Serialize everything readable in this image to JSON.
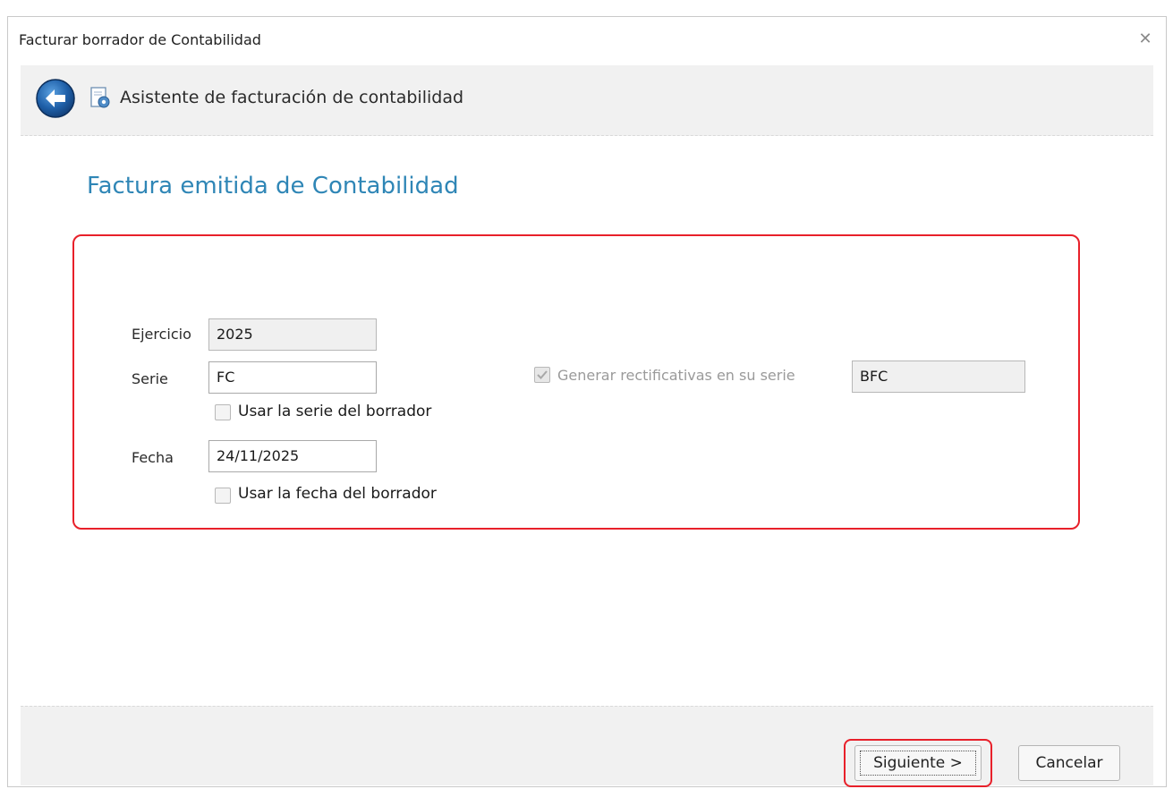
{
  "window": {
    "title": "Facturar borrador de Contabilidad",
    "close_glyph": "✕"
  },
  "wizard": {
    "title": "Asistente de facturación de contabilidad",
    "back_icon": "back-arrow-icon",
    "doc_icon": "document-gear-icon"
  },
  "page": {
    "heading": "Factura emitida de Contabilidad"
  },
  "form": {
    "ejercicio_label": "Ejercicio",
    "ejercicio_value": "2025",
    "serie_label": "Serie",
    "serie_value": "FC",
    "usar_serie_label": "Usar la serie del borrador",
    "usar_serie_checked": false,
    "fecha_label": "Fecha",
    "fecha_value": "24/11/2025",
    "usar_fecha_label": "Usar la fecha del borrador",
    "usar_fecha_checked": false,
    "rectificativas_label": "Generar rectificativas en su serie",
    "rectificativas_checked": true,
    "rectificativas_enabled": false,
    "rectificativas_serie_value": "BFC"
  },
  "footer": {
    "next_label": "Siguiente >",
    "cancel_label": "Cancelar"
  },
  "colors": {
    "accent_heading": "#2f86b6",
    "highlight": "#e8202a"
  }
}
